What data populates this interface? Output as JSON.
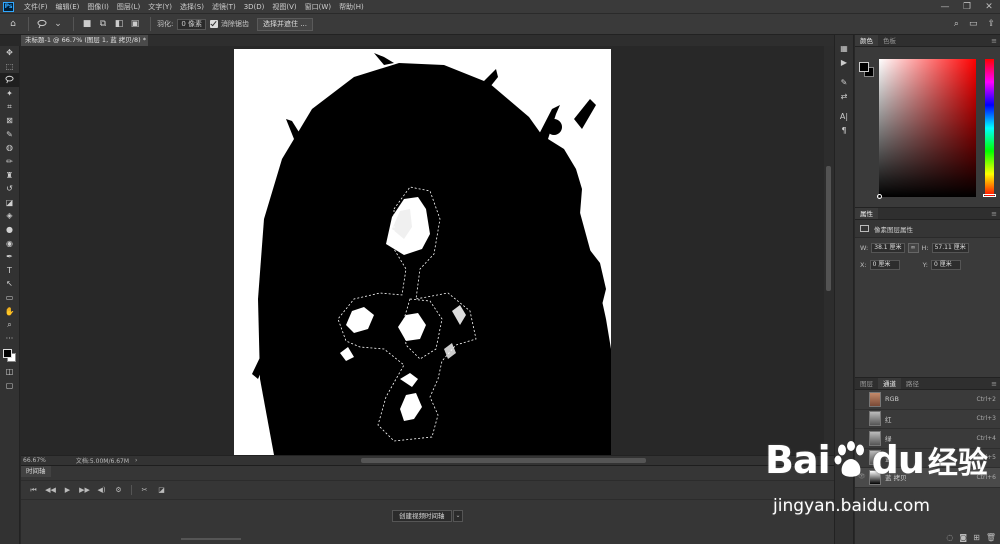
{
  "app": {
    "logo": "Ps"
  },
  "menu": [
    "文件(F)",
    "编辑(E)",
    "图像(I)",
    "图层(L)",
    "文字(Y)",
    "选择(S)",
    "滤镜(T)",
    "3D(D)",
    "视图(V)",
    "窗口(W)",
    "帮助(H)"
  ],
  "window_controls": [
    "—",
    "❐",
    "✕"
  ],
  "options": {
    "feather_label": "羽化:",
    "feather_value": "0 像素",
    "antialias_label": "消除锯齿",
    "select_mask_label": "选择并遮住 ..."
  },
  "document_tab": {
    "title": "未标题-1 @ 66.7% (图层 1, 蓝 拷贝/8) *",
    "close": "×"
  },
  "tools": [
    "move-tool",
    "marquee-tool",
    "lasso-tool",
    "magic-wand-tool",
    "crop-tool",
    "frame-tool",
    "eyedropper-tool",
    "healing-tool",
    "brush-tool",
    "stamp-tool",
    "history-brush-tool",
    "eraser-tool",
    "bucket-tool",
    "blur-tool",
    "dodge-tool",
    "pen-tool",
    "type-tool",
    "path-select-tool",
    "shape-tool",
    "hand-tool",
    "zoom-tool",
    "more-tool"
  ],
  "status": {
    "zoom": "66.67%",
    "doc": "文档:5.00M/6.67M",
    "arrow": "›"
  },
  "timeline": {
    "tab": "时间轴",
    "controls": [
      "⏮",
      "◀◀",
      "▶",
      "▶▶",
      "◀)",
      "⚙",
      "✂",
      "◪"
    ],
    "create_button": "创建视频时间轴",
    "dropdown": "⌄"
  },
  "color_panel": {
    "tabs": [
      "颜色",
      "色板"
    ],
    "menu": "≡"
  },
  "properties": {
    "tab": "属性",
    "layer_type": "像素图层属性",
    "w_label": "W:",
    "w_value": "38.1 厘米",
    "link": "∞",
    "h_label": "H:",
    "h_value": "57.11 厘米",
    "x_label": "X:",
    "x_value": "0 厘米",
    "y_label": "Y:",
    "y_value": "0 厘米"
  },
  "channels": {
    "tabs": [
      "图层",
      "通道",
      "路径"
    ],
    "rows": [
      {
        "name": "RGB",
        "shortcut": "Ctrl+2",
        "thumb": "t-rgb"
      },
      {
        "name": "红",
        "shortcut": "Ctrl+3",
        "thumb": "t-gray"
      },
      {
        "name": "绿",
        "shortcut": "Ctrl+4",
        "thumb": "t-gray"
      },
      {
        "name": "蓝",
        "shortcut": "Ctrl+5",
        "thumb": "t-gray"
      },
      {
        "name": "蓝 拷贝",
        "shortcut": "Ctrl+6",
        "thumb": "t-bw"
      }
    ]
  },
  "watermark": {
    "brand": "Bai",
    "brand2": "du",
    "cn": "经验",
    "url": "jingyan.baidu.com"
  }
}
